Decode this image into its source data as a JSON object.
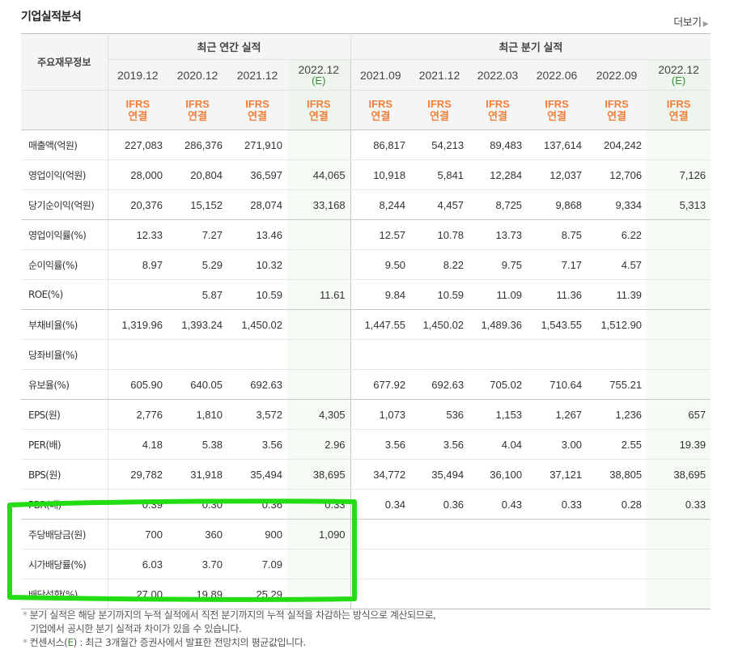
{
  "header": {
    "title": "기업실적분석",
    "more_label": "더보기"
  },
  "table": {
    "row_header_label": "주요재무정보",
    "groups": [
      "최근 연간 실적",
      "최근 분기 실적"
    ],
    "periods": [
      {
        "label": "2019.12",
        "est": ""
      },
      {
        "label": "2020.12",
        "est": ""
      },
      {
        "label": "2021.12",
        "est": ""
      },
      {
        "label": "2022.12",
        "est": "(E)"
      },
      {
        "label": "2021.09",
        "est": ""
      },
      {
        "label": "2021.12",
        "est": ""
      },
      {
        "label": "2022.03",
        "est": ""
      },
      {
        "label": "2022.06",
        "est": ""
      },
      {
        "label": "2022.09",
        "est": ""
      },
      {
        "label": "2022.12",
        "est": "(E)"
      }
    ],
    "ifrs_line1": "IFRS",
    "ifrs_line2": "연결",
    "rows": [
      {
        "label": "매출액(억원)",
        "values": [
          "227,083",
          "286,376",
          "271,910",
          "",
          "86,817",
          "54,213",
          "89,483",
          "137,614",
          "204,242",
          ""
        ]
      },
      {
        "label": "영업이익(억원)",
        "values": [
          "28,000",
          "20,804",
          "36,597",
          "44,065",
          "10,918",
          "5,841",
          "12,284",
          "12,037",
          "12,706",
          "7,126"
        ]
      },
      {
        "label": "당기순이익(억원)",
        "values": [
          "20,376",
          "15,152",
          "28,074",
          "33,168",
          "8,244",
          "4,457",
          "8,725",
          "9,868",
          "9,334",
          "5,313"
        ]
      },
      {
        "label": "영업이익률(%)",
        "values": [
          "12.33",
          "7.27",
          "13.46",
          "",
          "12.57",
          "10.78",
          "13.73",
          "8.75",
          "6.22",
          ""
        ]
      },
      {
        "label": "순이익률(%)",
        "values": [
          "8.97",
          "5.29",
          "10.32",
          "",
          "9.50",
          "8.22",
          "9.75",
          "7.17",
          "4.57",
          ""
        ]
      },
      {
        "label": "ROE(%)",
        "values": [
          "",
          "5.87",
          "10.59",
          "11.61",
          "9.84",
          "10.59",
          "11.09",
          "11.36",
          "11.39",
          ""
        ]
      },
      {
        "label": "부채비율(%)",
        "values": [
          "1,319.96",
          "1,393.24",
          "1,450.02",
          "",
          "1,447.55",
          "1,450.02",
          "1,489.36",
          "1,543.55",
          "1,512.90",
          ""
        ]
      },
      {
        "label": "당좌비율(%)",
        "values": [
          "",
          "",
          "",
          "",
          "",
          "",
          "",
          "",
          "",
          ""
        ]
      },
      {
        "label": "유보율(%)",
        "values": [
          "605.90",
          "640.05",
          "692.63",
          "",
          "677.92",
          "692.63",
          "705.02",
          "710.64",
          "755.21",
          ""
        ]
      },
      {
        "label": "EPS(원)",
        "values": [
          "2,776",
          "1,810",
          "3,572",
          "4,305",
          "1,073",
          "536",
          "1,153",
          "1,267",
          "1,236",
          "657"
        ]
      },
      {
        "label": "PER(배)",
        "values": [
          "4.18",
          "5.38",
          "3.56",
          "2.96",
          "3.56",
          "3.56",
          "4.04",
          "3.00",
          "2.55",
          "19.39"
        ]
      },
      {
        "label": "BPS(원)",
        "values": [
          "29,782",
          "31,918",
          "35,494",
          "38,695",
          "34,772",
          "35,494",
          "36,100",
          "37,121",
          "38,805",
          "38,695"
        ]
      },
      {
        "label": "PBR(배)",
        "values": [
          "0.39",
          "0.30",
          "0.36",
          "0.33",
          "0.34",
          "0.36",
          "0.43",
          "0.33",
          "0.28",
          "0.33"
        ]
      },
      {
        "label": "주당배당금(원)",
        "values": [
          "700",
          "360",
          "900",
          "1,090",
          "",
          "",
          "",
          "",
          "",
          ""
        ]
      },
      {
        "label": "시가배당률(%)",
        "values": [
          "6.03",
          "3.70",
          "7.09",
          "",
          "",
          "",
          "",
          "",
          "",
          ""
        ]
      },
      {
        "label": "배당성향(%)",
        "values": [
          "27.00",
          "19.89",
          "25.29",
          "",
          "",
          "",
          "",
          "",
          "",
          ""
        ]
      }
    ]
  },
  "notes": {
    "line1": "분기 실적은 해당 분기까지의 누적 실적에서 직전 분기까지의 누적 실적을 차감하는 방식으로 계산되므로,",
    "line2": "기업에서 공시한 분기 실적과 차이가 있을 수 있습니다.",
    "line3_prefix": "컨센서스(",
    "line3_e": "E",
    "line3_suffix": ") : 최근 3개월간 증권사에서 발표한 전망치의 평균값입니다."
  },
  "colors": {
    "highlight": "#22dd11",
    "ifrs": "#f07f3a",
    "estimate_bg": "#eef5ee"
  }
}
